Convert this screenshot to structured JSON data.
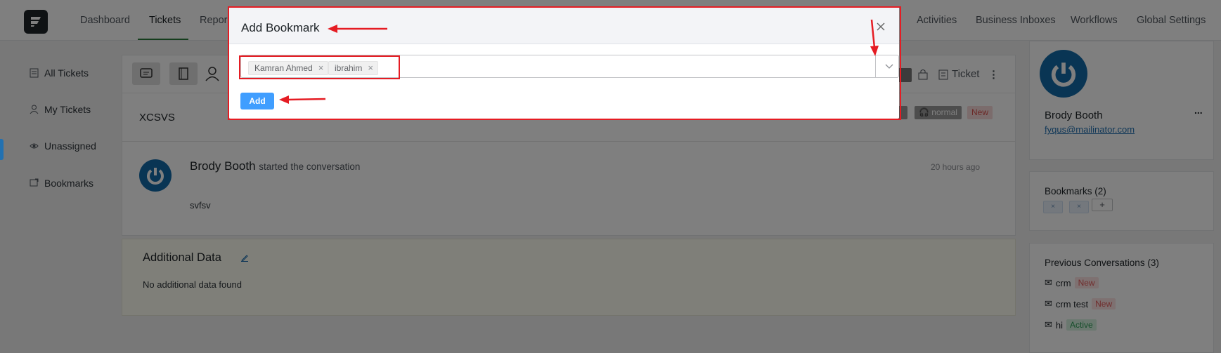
{
  "nav": {
    "items": [
      "Dashboard",
      "Tickets",
      "Repor",
      "Activities",
      "Business Inboxes",
      "Workflows",
      "Global Settings"
    ],
    "active": "Tickets"
  },
  "sidebar": {
    "items": [
      {
        "label": "All Tickets",
        "icon": "tickets-icon"
      },
      {
        "label": "My Tickets",
        "icon": "user-icon"
      },
      {
        "label": "Unassigned",
        "icon": "eye-icon"
      },
      {
        "label": "Bookmarks",
        "icon": "bookmark-icon"
      }
    ]
  },
  "ticket": {
    "title": "XCSVS",
    "priority_badge": "normal",
    "status_badge": "New",
    "right_label": "Ticket"
  },
  "conversation": {
    "author": "Brody Booth",
    "action": "started the conversation",
    "time": "20 hours ago",
    "body": "svfsv"
  },
  "additional_data": {
    "title": "Additional Data",
    "empty_text": "No additional data found"
  },
  "customer": {
    "name": "Brody Booth",
    "email": "fyqus@mailinator.com",
    "more": "..."
  },
  "bookmarks": {
    "title": "Bookmarks (2)",
    "add": "+"
  },
  "previous": {
    "title": "Previous Conversations (3)",
    "items": [
      {
        "subject": "crm",
        "status": "New"
      },
      {
        "subject": "crm test",
        "status": "New"
      },
      {
        "subject": "hi",
        "status": "Active"
      }
    ]
  },
  "modal": {
    "title": "Add Bookmark",
    "selected_tags": [
      "Kamran Ahmed",
      "ibrahim"
    ],
    "add_button": "Add"
  },
  "colors": {
    "primary": "#409eff",
    "annotation": "#e51c23",
    "brand_dark": "#1f2428",
    "avatar_blue": "#136aa8"
  }
}
